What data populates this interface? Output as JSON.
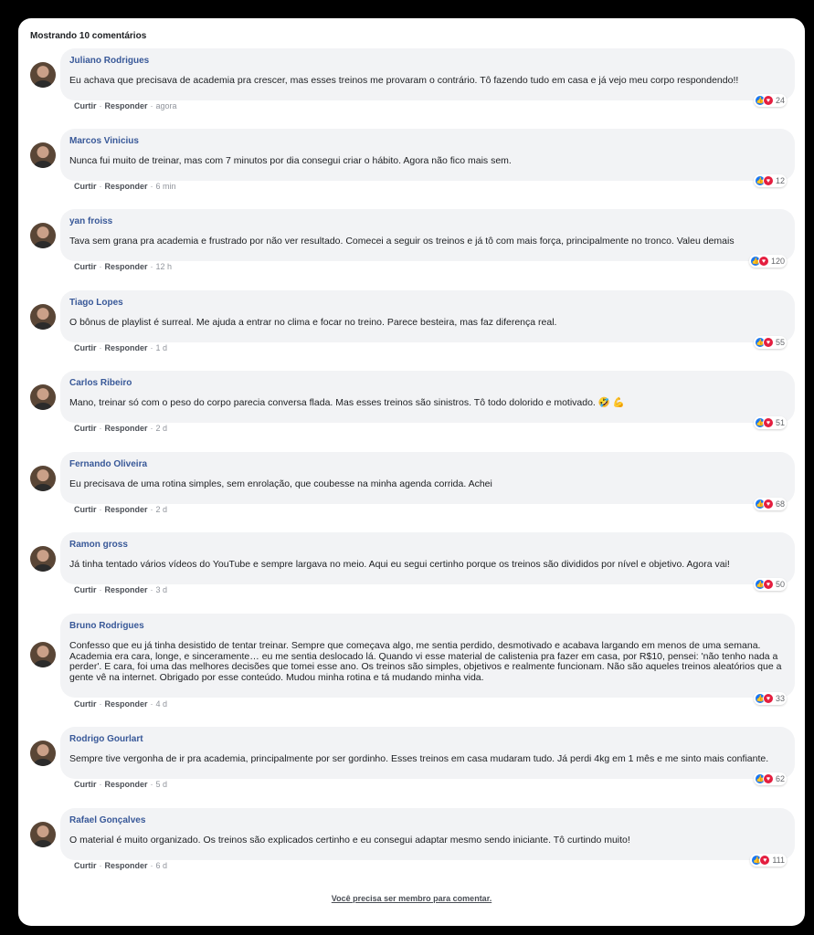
{
  "header": {
    "title": "Mostrando 10 comentários"
  },
  "actions": {
    "like": "Curtir",
    "reply": "Responder",
    "separator": "·"
  },
  "colors": {
    "author": "#385898",
    "bubble": "#f2f3f5",
    "like": "#1877f2",
    "love": "#e41e3f"
  },
  "comments": [
    {
      "author": "Juliano Rodrigues",
      "text": "Eu achava que precisava de academia pra crescer, mas esses treinos me provaram o contrário. Tô fazendo tudo em casa e já vejo meu corpo respondendo!!",
      "time": "agora",
      "reactions": "24"
    },
    {
      "author": "Marcos Vinicius",
      "text": "Nunca fui muito de treinar, mas com 7 minutos por dia consegui criar o hábito. Agora não fico mais sem.",
      "time": "6 min",
      "reactions": "12"
    },
    {
      "author": "yan froiss",
      "text": "Tava sem grana pra academia e frustrado por não ver resultado. Comecei a seguir os treinos e já tô com mais força, principalmente no tronco. Valeu demais",
      "time": "12 h",
      "reactions": "120"
    },
    {
      "author": "Tiago Lopes",
      "text": "O bônus de playlist é surreal. Me ajuda a entrar no clima e focar no treino. Parece besteira, mas faz diferença real.",
      "time": "1 d",
      "reactions": "55"
    },
    {
      "author": "Carlos Ribeiro",
      "text": "Mano, treinar só com o peso do corpo parecia conversa flada. Mas esses treinos são sinistros. Tô todo dolorido e motivado. 🤣 💪",
      "time": "2 d",
      "reactions": "51"
    },
    {
      "author": "Fernando Oliveira",
      "text": "Eu precisava de uma rotina simples, sem enrolação, que coubesse na minha agenda corrida. Achei",
      "time": "2 d",
      "reactions": "68"
    },
    {
      "author": "Ramon gross",
      "text": "Já tinha tentado vários vídeos do YouTube e sempre largava no meio. Aqui eu segui certinho porque os treinos são divididos por nível e objetivo. Agora vai!",
      "time": "3 d",
      "reactions": "50"
    },
    {
      "author": "Bruno Rodrigues",
      "text": "Confesso que eu já tinha desistido de tentar treinar. Sempre que começava algo, me sentia perdido, desmotivado e acabava largando em menos de uma semana. Academia era cara, longe, e sinceramente… eu me sentia deslocado lá. Quando vi esse material de calistenia pra fazer em casa, por R$10, pensei: 'não tenho nada a perder'. E cara, foi uma das melhores decisões que tomei esse ano. Os treinos são simples, objetivos e realmente funcionam. Não são aqueles treinos aleatórios que a gente vê na internet. Obrigado por esse conteúdo. Mudou minha rotina e tá mudando minha vida.",
      "time": "4 d",
      "reactions": "33"
    },
    {
      "author": "Rodrigo Gourlart",
      "text": "Sempre tive vergonha de ir pra academia, principalmente por ser gordinho. Esses treinos em casa mudaram tudo. Já perdi 4kg em 1 mês e me sinto mais confiante.",
      "time": "5 d",
      "reactions": "62"
    },
    {
      "author": "Rafael Gonçalves",
      "text": "O material é muito organizado. Os treinos são explicados certinho e eu consegui adaptar mesmo sendo iniciante. Tô curtindo muito!",
      "time": "6 d",
      "reactions": "111"
    }
  ],
  "footer": {
    "link": "Você precisa ser membro para comentar."
  }
}
